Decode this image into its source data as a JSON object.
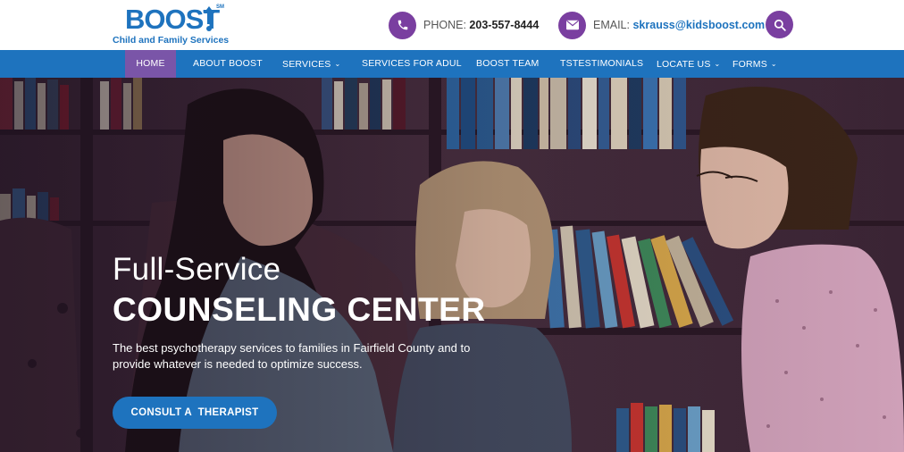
{
  "logo": {
    "brand": "Boost",
    "mark": "SM",
    "tagline": "Child and Family Services"
  },
  "header": {
    "phone": {
      "label": "PHONE:",
      "value": "203-557-8444",
      "icon": "phone-icon"
    },
    "email": {
      "label": "EMAIL:",
      "value": "skrauss@kidsboost.com",
      "icon": "envelope-icon"
    },
    "search_icon": "search-icon"
  },
  "nav": {
    "items": [
      {
        "label": "HOME",
        "active": true
      },
      {
        "label": "ABOUT BOOST"
      },
      {
        "label": "SERVICES",
        "dropdown": true
      },
      {
        "label": "SERVICES FOR ADUL"
      },
      {
        "label": "BOOST TEAM"
      },
      {
        "label": "TSTESTIMONIALS"
      },
      {
        "label": "LOCATE US",
        "dropdown": true
      },
      {
        "label": "FORMS",
        "dropdown": true
      }
    ]
  },
  "hero": {
    "title_line1": "Full-Service",
    "title_line2": "COUNSELING CENTER",
    "description": "The best psychotherapy services to families in Fairfield County and to provide whatever is needed to optimize success.",
    "cta_label": "CONSULT A  THERAPIST"
  },
  "colors": {
    "brand_blue": "#1e73be",
    "accent_purple": "#7a3fa0",
    "active_nav": "#7a55a8"
  }
}
